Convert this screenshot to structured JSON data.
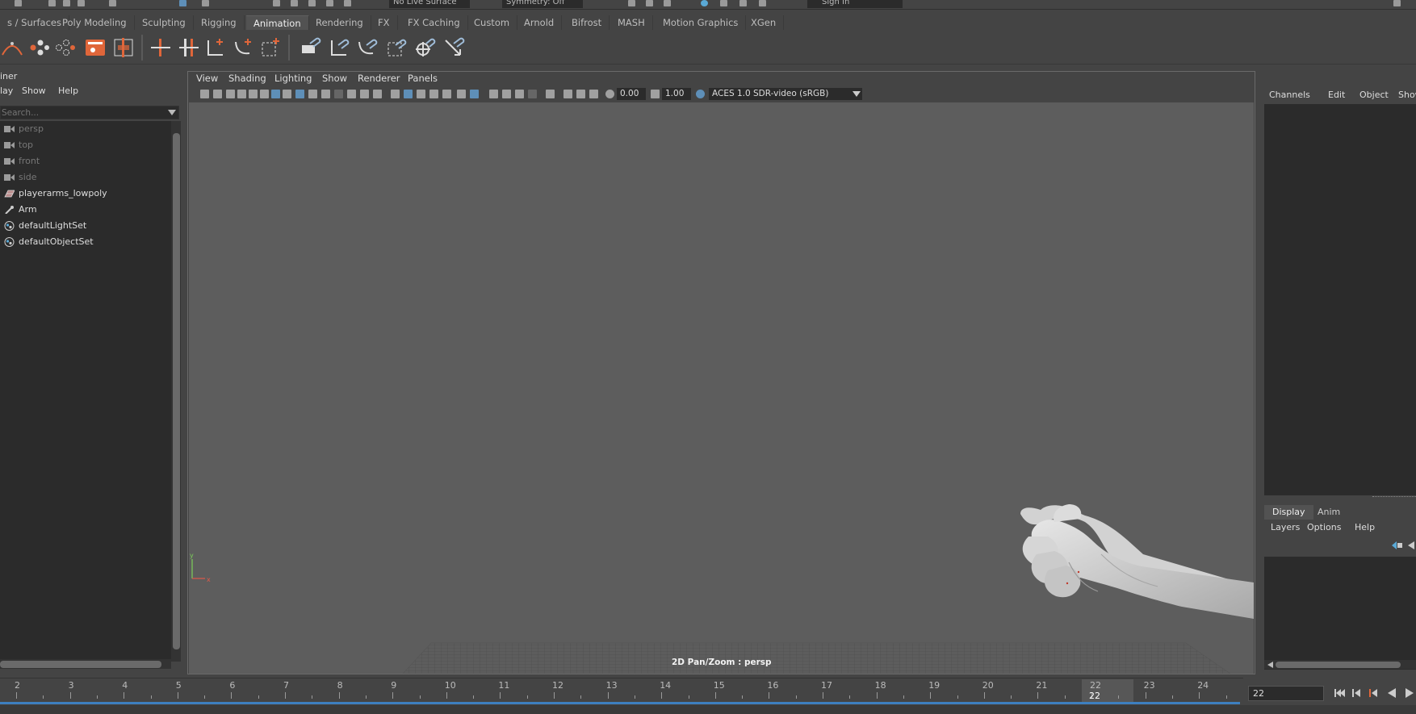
{
  "top_strip": {
    "live_surface": "No Live Surface",
    "symmetry": "Symmetry: Off",
    "sign_in": "Sign In"
  },
  "shelf_tabs": [
    {
      "label": "s / Surfaces",
      "active": false
    },
    {
      "label": "Poly Modeling",
      "active": false
    },
    {
      "label": "Sculpting",
      "active": false
    },
    {
      "label": "Rigging",
      "active": false
    },
    {
      "label": "Animation",
      "active": true
    },
    {
      "label": "Rendering",
      "active": false
    },
    {
      "label": "FX",
      "active": false
    },
    {
      "label": "FX Caching",
      "active": false
    },
    {
      "label": "Custom",
      "active": false
    },
    {
      "label": "Arnold",
      "active": false
    },
    {
      "label": "Bifrost",
      "active": false
    },
    {
      "label": "MASH",
      "active": false
    },
    {
      "label": "Motion Graphics",
      "active": false
    },
    {
      "label": "XGen",
      "active": false
    }
  ],
  "outliner": {
    "title": "iner",
    "menu": [
      "lay",
      "Show",
      "Help"
    ],
    "search_placeholder": "Search...",
    "items": [
      {
        "label": "persp",
        "icon": "camera-icon",
        "dim": true
      },
      {
        "label": "top",
        "icon": "camera-icon",
        "dim": true
      },
      {
        "label": "front",
        "icon": "camera-icon",
        "dim": true
      },
      {
        "label": "side",
        "icon": "camera-icon",
        "dim": true
      },
      {
        "label": "playerarms_lowpoly",
        "icon": "mesh-icon",
        "dim": false
      },
      {
        "label": "Arm",
        "icon": "joint-icon",
        "dim": false
      },
      {
        "label": "defaultLightSet",
        "icon": "set-icon",
        "dim": false
      },
      {
        "label": "defaultObjectSet",
        "icon": "set-icon",
        "dim": false
      }
    ]
  },
  "viewport": {
    "menu": [
      "View",
      "Shading",
      "Lighting",
      "Show",
      "Renderer",
      "Panels"
    ],
    "exposure": "0.00",
    "gamma": "1.00",
    "color_space": "ACES 1.0 SDR-video (sRGB)",
    "caption": "2D Pan/Zoom : persp"
  },
  "channel_box": {
    "menu": [
      "Channels",
      "Edit",
      "Object",
      "Show"
    ]
  },
  "layer_editor": {
    "tabs": [
      {
        "label": "Display",
        "active": true
      },
      {
        "label": "Anim",
        "active": false
      }
    ],
    "menu": [
      "Layers",
      "Options",
      "Help"
    ]
  },
  "time_slider": {
    "frames": [
      "2",
      "3",
      "4",
      "5",
      "6",
      "7",
      "8",
      "9",
      "10",
      "11",
      "12",
      "13",
      "14",
      "15",
      "16",
      "17",
      "18",
      "19",
      "20",
      "21",
      "22",
      "23",
      "24"
    ],
    "current_frame_label": "22",
    "current_frame_marker": "22",
    "current_frame_field": "22"
  },
  "colors": {
    "accent_orange": "#e0663a",
    "accent_blue": "#5aa9d6",
    "timeline_blue": "#3d7fbf"
  }
}
